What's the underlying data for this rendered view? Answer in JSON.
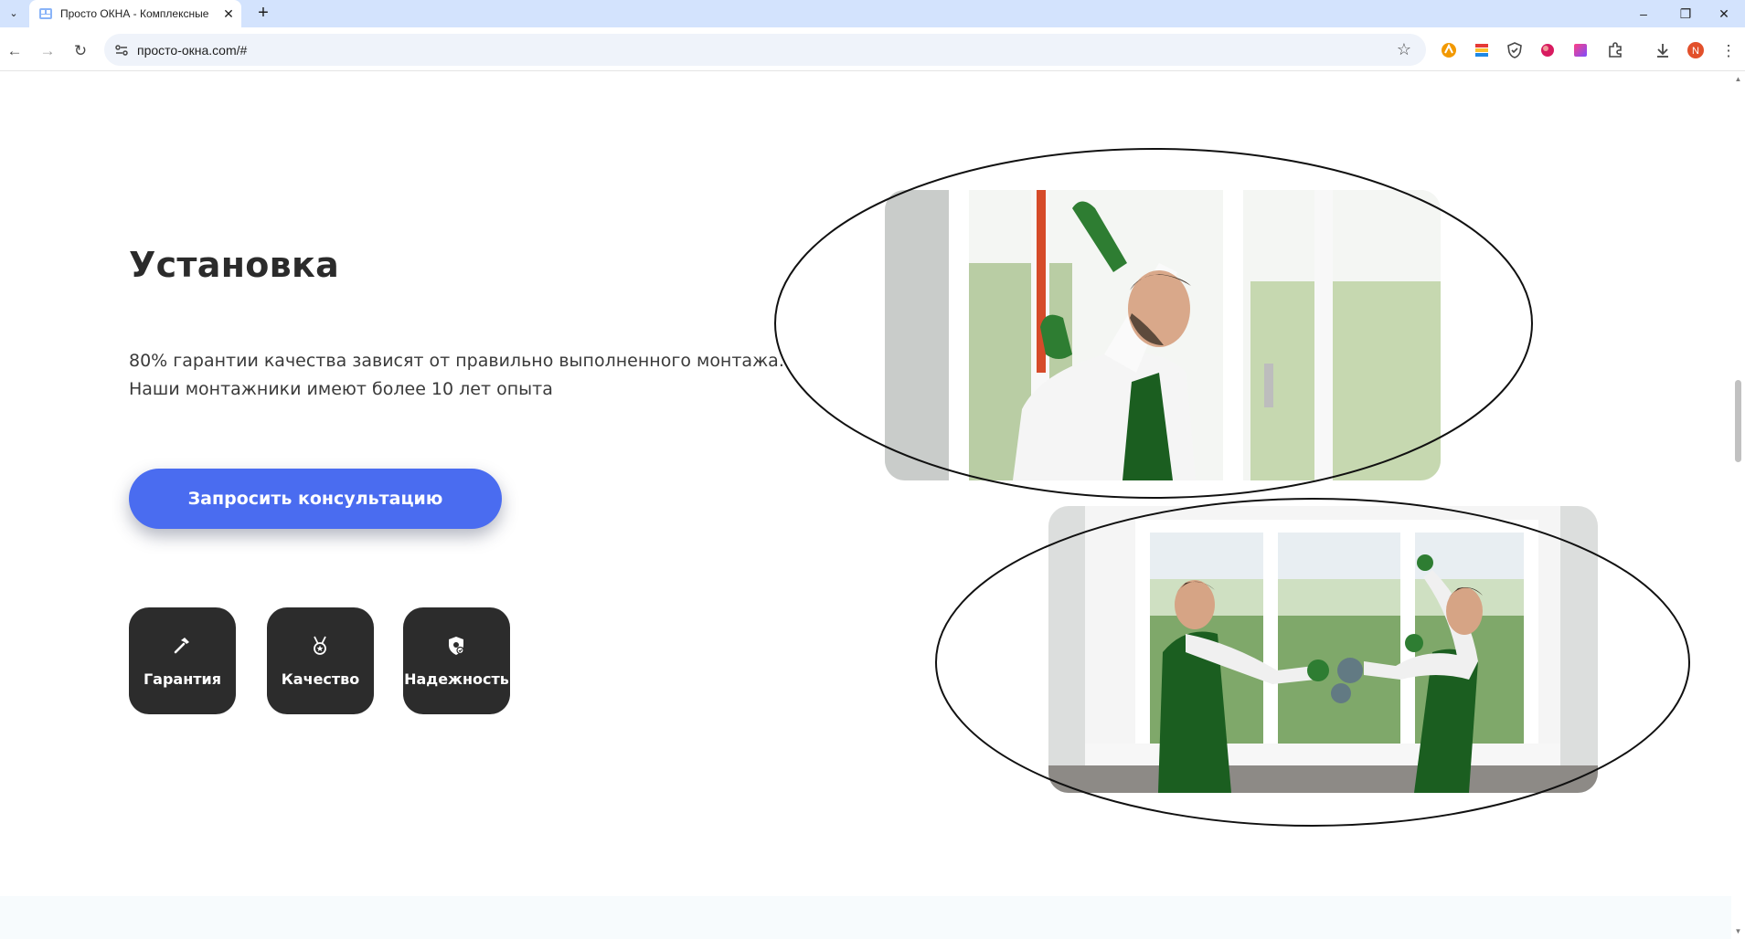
{
  "browser": {
    "tab_title": "Просто ОКНА - Комплексные",
    "url": "просто-окна.com/#",
    "profile_initial": "N"
  },
  "section": {
    "heading": "Установка",
    "description_line1": "80% гарантии качества зависят от правильно выполненного монтажа.",
    "description_line2": "Наши монтажники имеют более 10 лет опыта",
    "cta_label": "Запросить консультацию",
    "features": [
      {
        "label": "Гарантия",
        "icon": "hammer-icon"
      },
      {
        "label": "Качество",
        "icon": "medal-icon"
      },
      {
        "label": "Надежность",
        "icon": "shield-icon"
      }
    ]
  },
  "photos": [
    {
      "name": "worker-leveling-window-photo"
    },
    {
      "name": "two-workers-installing-window-photo"
    }
  ],
  "colors": {
    "accent": "#4a6cf0",
    "tile": "#2c2c2c",
    "tabbar": "#d3e3fd",
    "heading": "#2b2b2b"
  }
}
